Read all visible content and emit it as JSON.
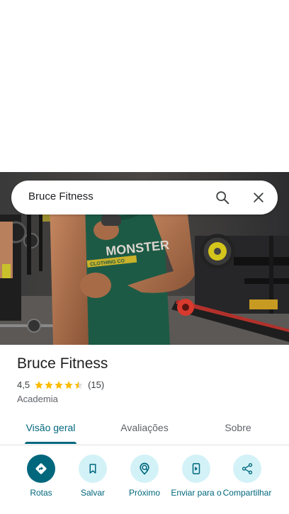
{
  "search": {
    "query": "Bruce Fitness"
  },
  "photo": {
    "shirt_print_line1": "MONSTER",
    "shirt_print_line2": "CLOTHING CO"
  },
  "place": {
    "name": "Bruce Fitness",
    "rating": "4,5",
    "rating_stars": 4.5,
    "review_count": "(15)",
    "category": "Academia"
  },
  "tabs": [
    {
      "label": "Visão geral",
      "active": true
    },
    {
      "label": "Avaliações",
      "active": false
    },
    {
      "label": "Sobre",
      "active": false
    }
  ],
  "actions": [
    {
      "label": "Rotas",
      "icon": "directions-icon"
    },
    {
      "label": "Salvar",
      "icon": "bookmark-icon"
    },
    {
      "label": "Próximo",
      "icon": "nearby-icon"
    },
    {
      "label": "Enviar para o",
      "icon": "send-to-phone-icon"
    },
    {
      "label": "Compartilhar",
      "icon": "share-icon"
    }
  ],
  "colors": {
    "accent": "#00677d",
    "action_bg": "#d3f2f7",
    "star": "#fbbc04"
  }
}
